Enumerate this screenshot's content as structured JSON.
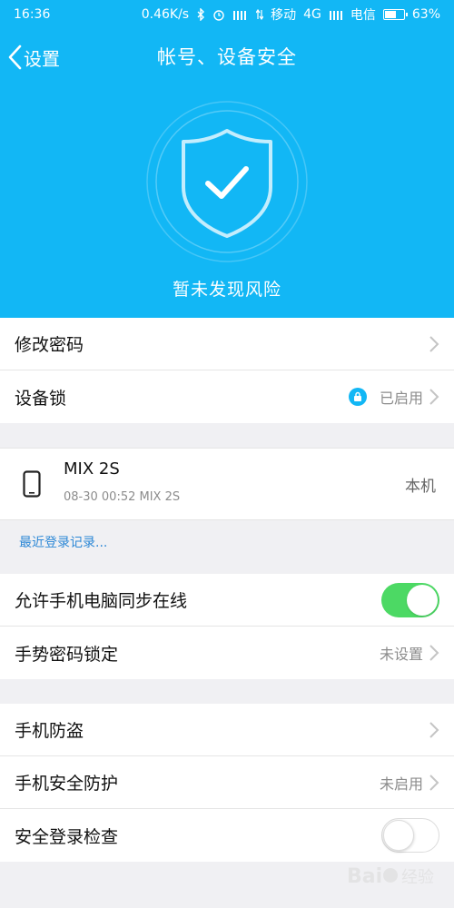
{
  "statusbar": {
    "time": "16:36",
    "speed": "0.46K/s",
    "carrier1": "移动",
    "network": "4G",
    "carrier2": "电信",
    "battery": "63%",
    "battery_level": 0.63
  },
  "navbar": {
    "back_label": "设置",
    "title": "帐号、设备安全"
  },
  "hero": {
    "status_text": "暂未发现风险"
  },
  "security": {
    "change_password": "修改密码",
    "device_lock": "设备锁",
    "device_lock_status": "已启用"
  },
  "device": {
    "name": "MIX 2S",
    "meta": "08-30 00:52 MIX 2S",
    "tag": "本机"
  },
  "recent_login_link": "最近登录记录...",
  "sync": {
    "allow_sync": "允许手机电脑同步在线",
    "allow_sync_on": true,
    "gesture_lock": "手势密码锁定",
    "gesture_lock_status": "未设置"
  },
  "protection": {
    "anti_theft": "手机防盗",
    "phone_security": "手机安全防护",
    "phone_security_status": "未启用",
    "login_check": "安全登录检查",
    "login_check_on": false
  },
  "colors": {
    "primary": "#12b7f5",
    "toggle_on": "#4cd964",
    "link": "#2d88d6"
  }
}
